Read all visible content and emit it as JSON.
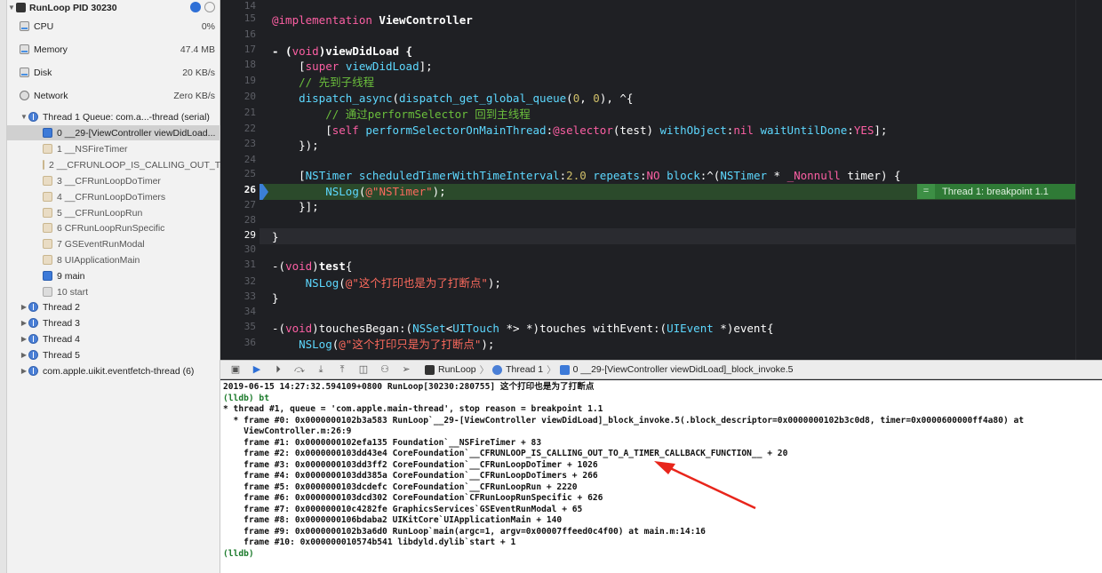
{
  "navigator": {
    "process": {
      "label": "RunLoop PID 30230"
    },
    "gauges": [
      {
        "name": "CPU",
        "value": "0%"
      },
      {
        "name": "Memory",
        "value": "47.4 MB"
      },
      {
        "name": "Disk",
        "value": "20 KB/s"
      },
      {
        "name": "Network",
        "value": "Zero KB/s"
      }
    ],
    "thread1": {
      "label": "Thread 1 Queue: com.a...-thread (serial)"
    },
    "frames": [
      "0 __29-[ViewController viewDidLoad...",
      "1 __NSFireTimer",
      "2 __CFRUNLOOP_IS_CALLING_OUT_T...",
      "3 __CFRunLoopDoTimer",
      "4 __CFRunLoopDoTimers",
      "5 __CFRunLoopRun",
      "6 CFRunLoopRunSpecific",
      "7 GSEventRunModal",
      "8 UIApplicationMain",
      "9 main",
      "10 start"
    ],
    "threads": [
      "Thread 2",
      "Thread 3",
      "Thread 4",
      "Thread 5",
      "com.apple.uikit.eventfetch-thread (6)"
    ]
  },
  "editor": {
    "line_numbers": [
      "14",
      "15",
      "16",
      "17",
      "18",
      "19",
      "20",
      "21",
      "22",
      "23",
      "24",
      "25",
      "26",
      "27",
      "28",
      "29",
      "30",
      "31",
      "32",
      "33",
      "34",
      "35",
      "36"
    ],
    "breakpoint_badge": "Thread 1: breakpoint 1.1"
  },
  "debug_bar": {
    "crumbs": [
      "RunLoop",
      "Thread 1",
      "0 __29-[ViewController viewDidLoad]_block_invoke.5"
    ]
  },
  "console": {
    "lines": [
      "2019-06-15 14:27:32.594109+0800 RunLoop[30230:280755] 这个打印也是为了打断点",
      "(lldb) bt",
      "* thread #1, queue = 'com.apple.main-thread', stop reason = breakpoint 1.1",
      "  * frame #0: 0x0000000102b3a583 RunLoop`__29-[ViewController viewDidLoad]_block_invoke.5(.block_descriptor=0x0000000102b3c0d8, timer=0x0000600000ff4a80) at",
      "    ViewController.m:26:9",
      "    frame #1: 0x0000000102efa135 Foundation`__NSFireTimer + 83",
      "    frame #2: 0x0000000103dd43e4 CoreFoundation`__CFRUNLOOP_IS_CALLING_OUT_TO_A_TIMER_CALLBACK_FUNCTION__ + 20",
      "    frame #3: 0x0000000103dd3ff2 CoreFoundation`__CFRunLoopDoTimer + 1026",
      "    frame #4: 0x0000000103dd385a CoreFoundation`__CFRunLoopDoTimers + 266",
      "    frame #5: 0x0000000103dcdefc CoreFoundation`__CFRunLoopRun + 2220",
      "    frame #6: 0x0000000103dcd302 CoreFoundation`CFRunLoopRunSpecific + 626",
      "    frame #7: 0x000000010c4282fe GraphicsServices`GSEventRunModal + 65",
      "    frame #8: 0x0000000106bdaba2 UIKitCore`UIApplicationMain + 140",
      "    frame #9: 0x0000000102b3a6d0 RunLoop`main(argc=1, argv=0x00007ffeed0c4f00) at main.m:14:16",
      "    frame #10: 0x000000010574b541 libdyld.dylib`start + 1",
      "(lldb)"
    ]
  },
  "colors": {
    "keyword": "#fc5fa3",
    "string": "#fc6a5d",
    "comment": "#6bbf3c",
    "type": "#5dd8ff",
    "breakpoint": "#3b7fd6",
    "arrow": "#e8251b"
  }
}
